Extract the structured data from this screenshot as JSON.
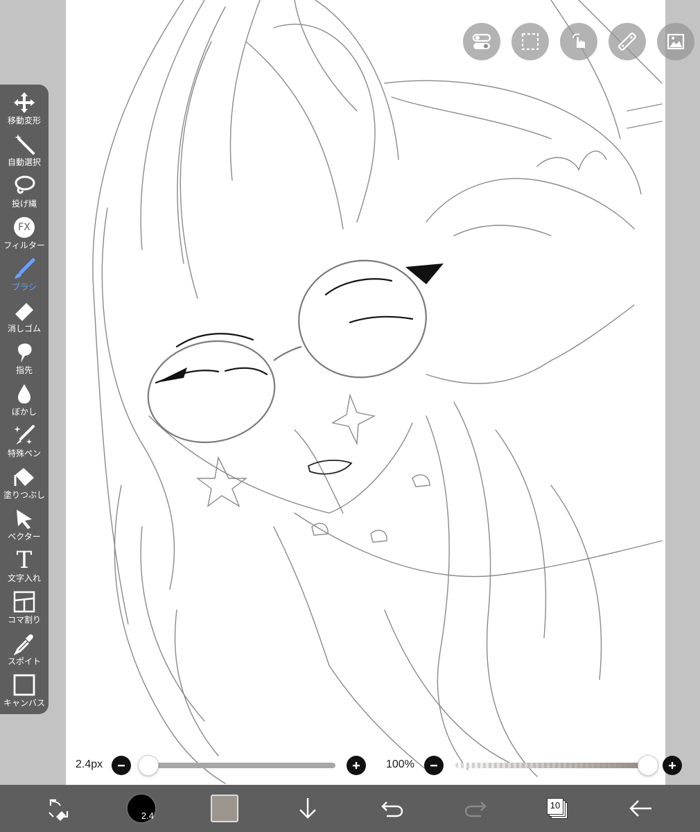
{
  "toolbar": {
    "items": [
      {
        "label": "移動変形",
        "icon": "move-icon"
      },
      {
        "label": "自動選択",
        "icon": "magic-wand-icon"
      },
      {
        "label": "投げ縄",
        "icon": "lasso-icon"
      },
      {
        "label": "フィルター",
        "icon": "fx-icon",
        "icon_text": "FX"
      },
      {
        "label": "ブラシ",
        "icon": "brush-icon",
        "active": true
      },
      {
        "label": "消しゴム",
        "icon": "eraser-icon"
      },
      {
        "label": "指先",
        "icon": "finger-smudge-icon"
      },
      {
        "label": "ぼかし",
        "icon": "blur-drop-icon"
      },
      {
        "label": "特殊ペン",
        "icon": "special-pen-icon"
      },
      {
        "label": "塗りつぶし",
        "icon": "fill-bucket-icon"
      },
      {
        "label": "ベクター",
        "icon": "vector-arrow-icon"
      },
      {
        "label": "文字入れ",
        "icon": "text-icon",
        "icon_text": "T"
      },
      {
        "label": "コマ割り",
        "icon": "frame-divider-icon"
      },
      {
        "label": "スポイト",
        "icon": "eyedropper-icon"
      },
      {
        "label": "キャンバス",
        "icon": "canvas-icon"
      }
    ],
    "active_color": "#6aa0ff"
  },
  "top_buttons": [
    "toggle-icon",
    "selection-icon",
    "touch-gesture-icon",
    "ruler-icon",
    "image-icon"
  ],
  "sliders": {
    "brush_size": {
      "label": "2.4px",
      "value": 0.0
    },
    "opacity": {
      "label": "100%",
      "value": 1.0
    }
  },
  "bottom_bar": {
    "brush_size_badge": "2.4",
    "current_color": "#9c958e",
    "layer_count": "10",
    "icons": [
      "transform-swap-icon",
      "brush-preview-icon",
      "color-swatch",
      "download-arrow-icon",
      "undo-icon",
      "redo-icon",
      "layers-icon",
      "back-arrow-icon"
    ]
  },
  "colors": {
    "toolbar_bg": "#5e5e5e",
    "workspace_bg": "#c3c3c3",
    "canvas_bg": "#ffffff"
  }
}
